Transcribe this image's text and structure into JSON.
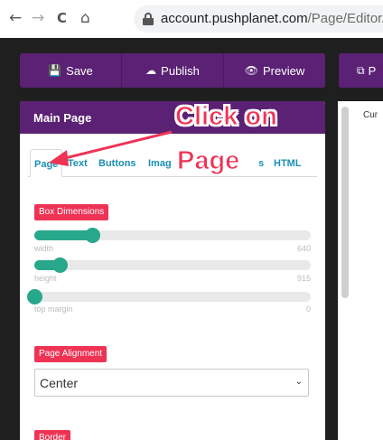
{
  "browser": {
    "back_glyph": "←",
    "forward_glyph": "→",
    "reload_glyph": "C",
    "home_glyph": "⌂",
    "url_domain": "account.pushplanet.com",
    "url_path": "/Page/Editor/"
  },
  "toolbar": {
    "save_label": "Save",
    "publish_label": "Publish",
    "preview_label": "Preview",
    "save_icon": "💾",
    "publish_icon": "☁",
    "preview_icon": "👁",
    "right_icon": "⧉",
    "right_label": "P"
  },
  "panel": {
    "title": "Main Page",
    "tabs": [
      "Page",
      "Text",
      "Buttons",
      "Imag",
      "s",
      "HTML"
    ],
    "box_dimensions_label": "Box Dimensions",
    "sliders": [
      {
        "name": "width",
        "value": "640",
        "fraction": 0.21
      },
      {
        "name": "height",
        "value": "915",
        "fraction": 0.09
      },
      {
        "name": "top margin",
        "value": "0",
        "fraction": 0.0
      }
    ],
    "page_alignment_label": "Page Alignment",
    "alignment_value": "Center",
    "border_label": "Border"
  },
  "right_panel": {
    "text": "Cur"
  },
  "annotation": {
    "line1": "Click on",
    "line2": "Page"
  },
  "colors": {
    "purple": "#5b2174",
    "teal": "#27a88a",
    "red": "#ee3355",
    "tab_blue": "#1a8fb5"
  }
}
